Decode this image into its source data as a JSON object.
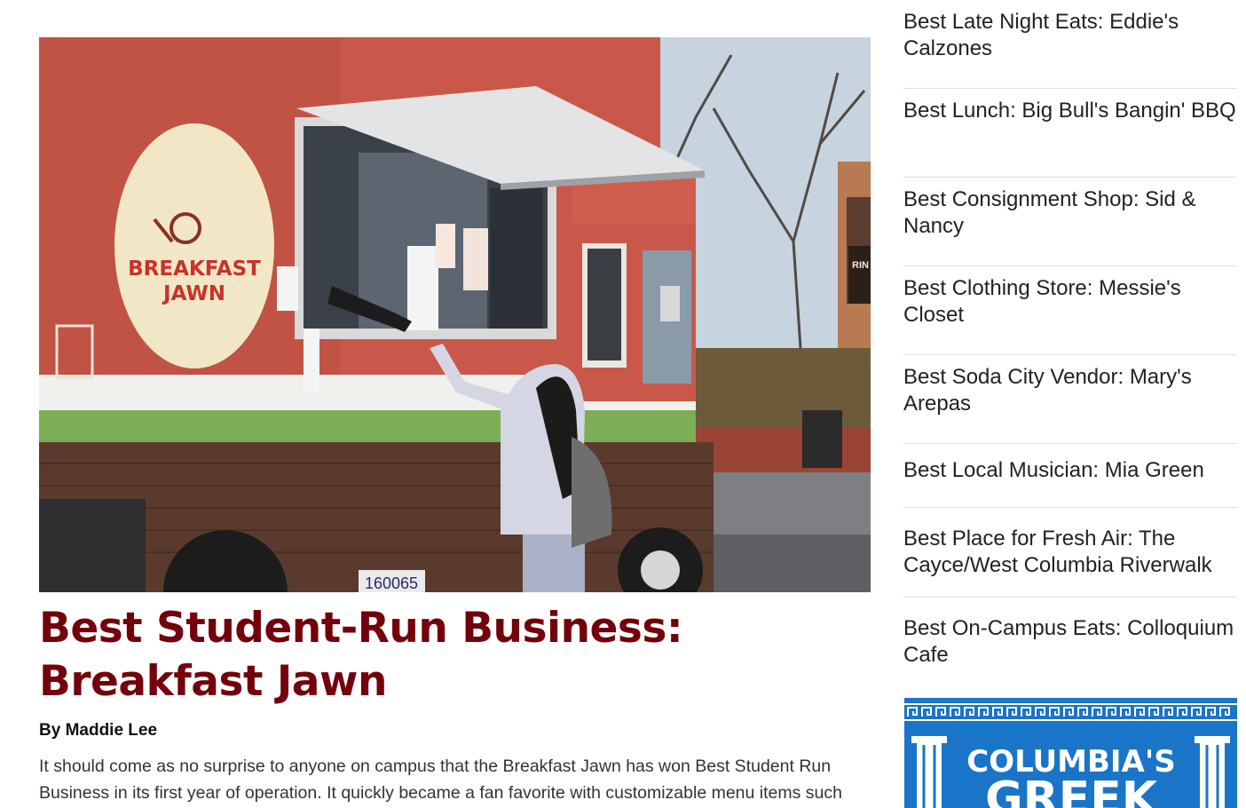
{
  "article": {
    "headline": "Best Student-Run Business: Breakfast Jawn",
    "byline": "By Maddie Lee",
    "body": "It should come as no surprise to anyone on campus that the Breakfast Jawn has won Best Student Run Business in its first year of operation. It quickly became a fan favorite with customizable menu items such",
    "truck_logo_line1": "BREAKFAST",
    "truck_logo_line2": "JAWN",
    "plate_text": "160065",
    "sign_text": "RIN WE"
  },
  "sidebar": {
    "items": [
      {
        "label": "Best Late Night Eats: Eddie's Calzones"
      },
      {
        "label": "Best Lunch: Big Bull's Bangin' BBQ"
      },
      {
        "label": "Best Consignment Shop: Sid & Nancy"
      },
      {
        "label": "Best Clothing Store: Messie's Closet"
      },
      {
        "label": "Best Soda City Vendor: Mary's Arepas"
      },
      {
        "label": "Best Local Musician: Mia Green"
      },
      {
        "label": "Best Place for Fresh Air: The Cayce/West Columbia Riverwalk"
      },
      {
        "label": "Best On-Campus Eats: Colloquium Cafe"
      }
    ],
    "ad": {
      "line1": "COLUMBIA'S",
      "line2": "GREEK"
    }
  },
  "colors": {
    "headline": "#73000a",
    "ad_blue": "#1a74c8",
    "truck_red": "#c9584a"
  }
}
